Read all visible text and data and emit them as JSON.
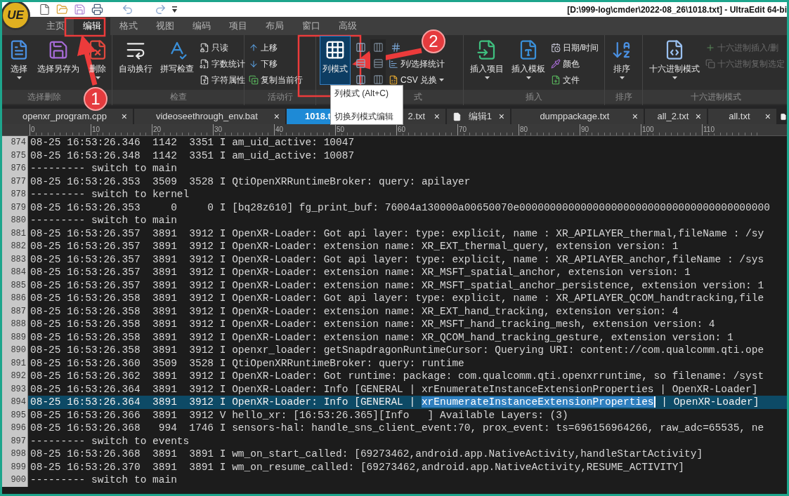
{
  "title_bar": {
    "logo": "UE",
    "title": "[D:\\999-log\\cmder\\2022-08_26\\1018.txt] - UltraEdit 64-bi"
  },
  "ribbon": {
    "tabs": [
      {
        "label": "主页",
        "selected": false
      },
      {
        "label": "编辑",
        "selected": true
      },
      {
        "label": "格式",
        "selected": false
      },
      {
        "label": "视图",
        "selected": false
      },
      {
        "label": "编码",
        "selected": false
      },
      {
        "label": "项目",
        "selected": false
      },
      {
        "label": "布局",
        "selected": false
      },
      {
        "label": "窗口",
        "selected": false
      },
      {
        "label": "高级",
        "selected": false
      }
    ],
    "groups": [
      {
        "label": "选择删除",
        "items": [
          {
            "kind": "large",
            "label": "选择",
            "dropdown": true
          },
          {
            "kind": "large",
            "label": "选择另存为",
            "dropdown": false
          },
          {
            "kind": "large",
            "label": "删除",
            "dropdown": true
          }
        ]
      },
      {
        "label": "检查",
        "items": [
          {
            "kind": "large",
            "label": "自动换行",
            "dropdown": false
          },
          {
            "kind": "large",
            "label": "拼写检查",
            "dropdown": false
          },
          {
            "kind": "column",
            "rows": [
              {
                "kind": "small",
                "label": "只读",
                "disabled": false
              },
              {
                "kind": "small",
                "label": "字数统计",
                "disabled": false
              },
              {
                "kind": "small",
                "label": "字符属性",
                "disabled": false
              }
            ]
          }
        ]
      },
      {
        "label": "活动行",
        "items": [
          {
            "kind": "column",
            "rows": [
              {
                "kind": "small",
                "label": "上移",
                "disabled": false
              },
              {
                "kind": "small",
                "label": "下移",
                "disabled": false
              },
              {
                "kind": "small",
                "label": "复制当前行",
                "disabled": false
              }
            ]
          }
        ]
      },
      {
        "label": "式",
        "items": [
          {
            "kind": "large",
            "label": "列模式",
            "dropdown": false,
            "selected": true
          },
          {
            "kind": "column",
            "rows": [
              {
                "kind": "icon",
                "disabled": false
              },
              {
                "kind": "icon",
                "disabled": false
              },
              {
                "kind": "icon",
                "disabled": false
              }
            ]
          },
          {
            "kind": "column",
            "rows": [
              {
                "kind": "icon",
                "disabled": true
              },
              {
                "kind": "icon",
                "disabled": true
              },
              {
                "kind": "icon",
                "disabled": true
              }
            ]
          },
          {
            "kind": "column",
            "rows": [
              {
                "kind": "icon",
                "disabled": false
              },
              {
                "kind": "small",
                "label": "列/选择统计",
                "disabled": false
              },
              {
                "kind": "small",
                "label": "CSV 兑换",
                "disabled": false,
                "dropdown": true
              }
            ]
          }
        ]
      },
      {
        "label": "插入",
        "items": [
          {
            "kind": "large",
            "label": "插入项目",
            "dropdown": true
          },
          {
            "kind": "large",
            "label": "插入模板",
            "dropdown": true
          },
          {
            "kind": "column",
            "rows": [
              {
                "kind": "small",
                "label": "日期/时间",
                "disabled": false
              },
              {
                "kind": "small",
                "label": "颜色",
                "disabled": false
              },
              {
                "kind": "small",
                "label": "文件",
                "disabled": false
              }
            ]
          }
        ]
      },
      {
        "label": "排序",
        "items": [
          {
            "kind": "large",
            "label": "排序",
            "dropdown": true
          }
        ]
      },
      {
        "label": "十六进制模式",
        "items": [
          {
            "kind": "large",
            "label": "十六进制模式",
            "dropdown": true
          },
          {
            "kind": "column",
            "rows": [
              {
                "kind": "small",
                "label": "十六进制插入/删",
                "disabled": true
              },
              {
                "kind": "small",
                "label": "十六进制复制选定",
                "disabled": true
              }
            ]
          }
        ]
      }
    ]
  },
  "tooltip": {
    "title": "列模式 (Alt+C)",
    "description": "切换列模式编辑"
  },
  "file_tabs": [
    {
      "label": "openxr_program.cpp",
      "close": "×",
      "selected": false
    },
    {
      "label": "videoseethrough_env.bat",
      "close": "×",
      "selected": false
    },
    {
      "label": "1018.t",
      "selected": true
    },
    {
      "label": "2.txt",
      "close": "×",
      "selected": false
    },
    {
      "label": "编辑1",
      "close": "×",
      "selected": false,
      "kind": "new"
    },
    {
      "label": "dumppackage.txt",
      "close": "×",
      "selected": false
    },
    {
      "label": "all_2.txt",
      "close": "×",
      "selected": false
    },
    {
      "label": "all.txt",
      "close": "×",
      "selected": false
    }
  ],
  "ruler": [
    "0",
    "10",
    "20",
    "30",
    "40",
    "50",
    "60",
    "70",
    "80",
    "90",
    "100",
    "110"
  ],
  "editor": {
    "lines": [
      {
        "number": "874",
        "text": "08-25 16:53:26.346  1142  3351 I am_uid_active: 10047",
        "selected": false
      },
      {
        "number": "875",
        "text": "08-25 16:53:26.348  1142  3351 I am_uid_active: 10087",
        "selected": false
      },
      {
        "number": "876",
        "text": "--------- switch to main",
        "selected": false
      },
      {
        "number": "877",
        "text": "08-25 16:53:26.353  3509  3528 I QtiOpenXRRuntimeBroker: query: apilayer",
        "selected": false
      },
      {
        "number": "878",
        "text": "--------- switch to kernel",
        "selected": false
      },
      {
        "number": "879",
        "text": "08-25 16:53:26.353     0     0 I [bq28z610] fg_print_buf: 76004a130000a00650070e00000000000000000000000000000000000000000",
        "selected": false
      },
      {
        "number": "880",
        "text": "--------- switch to main",
        "selected": false
      },
      {
        "number": "881",
        "text": "08-25 16:53:26.357  3891  3912 I OpenXR-Loader: Got api layer: type: explicit, name : XR_APILAYER_thermal,fileName : /sy",
        "selected": false
      },
      {
        "number": "882",
        "text": "08-25 16:53:26.357  3891  3912 I OpenXR-Loader: extension name: XR_EXT_thermal_query, extension version: 1",
        "selected": false
      },
      {
        "number": "883",
        "text": "08-25 16:53:26.357  3891  3912 I OpenXR-Loader: Got api layer: type: explicit, name : XR_APILAYER_anchor,fileName : /sys",
        "selected": false
      },
      {
        "number": "884",
        "text": "08-25 16:53:26.357  3891  3912 I OpenXR-Loader: extension name: XR_MSFT_spatial_anchor, extension version: 1",
        "selected": false
      },
      {
        "number": "885",
        "text": "08-25 16:53:26.357  3891  3912 I OpenXR-Loader: extension name: XR_MSFT_spatial_anchor_persistence, extension version: 1",
        "selected": false
      },
      {
        "number": "886",
        "text": "08-25 16:53:26.358  3891  3912 I OpenXR-Loader: Got api layer: type: explicit, name : XR_APILAYER_QCOM_handtracking,file",
        "selected": false
      },
      {
        "number": "887",
        "text": "08-25 16:53:26.358  3891  3912 I OpenXR-Loader: extension name: XR_EXT_hand_tracking, extension version: 4",
        "selected": false
      },
      {
        "number": "888",
        "text": "08-25 16:53:26.358  3891  3912 I OpenXR-Loader: extension name: XR_MSFT_hand_tracking_mesh, extension version: 4",
        "selected": false
      },
      {
        "number": "889",
        "text": "08-25 16:53:26.358  3891  3912 I OpenXR-Loader: extension name: XR_QCOM_hand_tracking_gesture, extension version: 1",
        "selected": false
      },
      {
        "number": "890",
        "text": "08-25 16:53:26.358  3891  3912 I openxr_loader: getSnapdragonRuntimeCursor: Querying URI: content://com.qualcomm.qti.ope",
        "selected": false
      },
      {
        "number": "891",
        "text": "08-25 16:53:26.360  3509  3528 I QtiOpenXRRuntimeBroker: query: runtime",
        "selected": false
      },
      {
        "number": "892",
        "text": "08-25 16:53:26.362  3891  3912 I OpenXR-Loader: Got runtime: package: com.qualcomm.qti.openxrruntime, so filename: /syst",
        "selected": false
      },
      {
        "number": "893",
        "text": "08-25 16:53:26.364  3891  3912 I OpenXR-Loader: Info [GENERAL | xrEnumerateInstanceExtensionProperties | OpenXR-Loader]",
        "selected": false
      },
      {
        "number": "894",
        "selected": true,
        "segments": [
          {
            "text": "08-25 16:53:26.364  3891  3912 I OpenXR-Loader: Info [GENERAL | ",
            "selected": false
          },
          {
            "text": "xrEnumerateInstanceExtensionProperties",
            "selected": true
          },
          {
            "text": " | OpenXR-Loader]",
            "selected": false
          }
        ]
      },
      {
        "number": "895",
        "text": "08-25 16:53:26.366  3891  3912 V hello_xr: [16:53:26.365][Info   ] Available Layers: (3)",
        "selected": false
      },
      {
        "number": "896",
        "text": "08-25 16:53:26.368   994  1746 I sensors-hal: handle_sns_client_event:70, prox_event: ts=696156964266, raw_adc=65535, ne",
        "selected": false
      },
      {
        "number": "897",
        "text": "--------- switch to events",
        "selected": false
      },
      {
        "number": "898",
        "text": "08-25 16:53:26.368  3891  3891 I wm_on_start_called: [69273462,android.app.NativeActivity,handleStartActivity]",
        "selected": false
      },
      {
        "number": "899",
        "text": "08-25 16:53:26.370  3891  3891 I wm_on_resume_called: [69273462,android.app.NativeActivity,RESUME_ACTIVITY]",
        "selected": false
      },
      {
        "number": "900",
        "text": "--------- switch to main",
        "selected": false
      }
    ]
  },
  "annotations": [
    {
      "number": "1"
    },
    {
      "number": "2"
    }
  ]
}
